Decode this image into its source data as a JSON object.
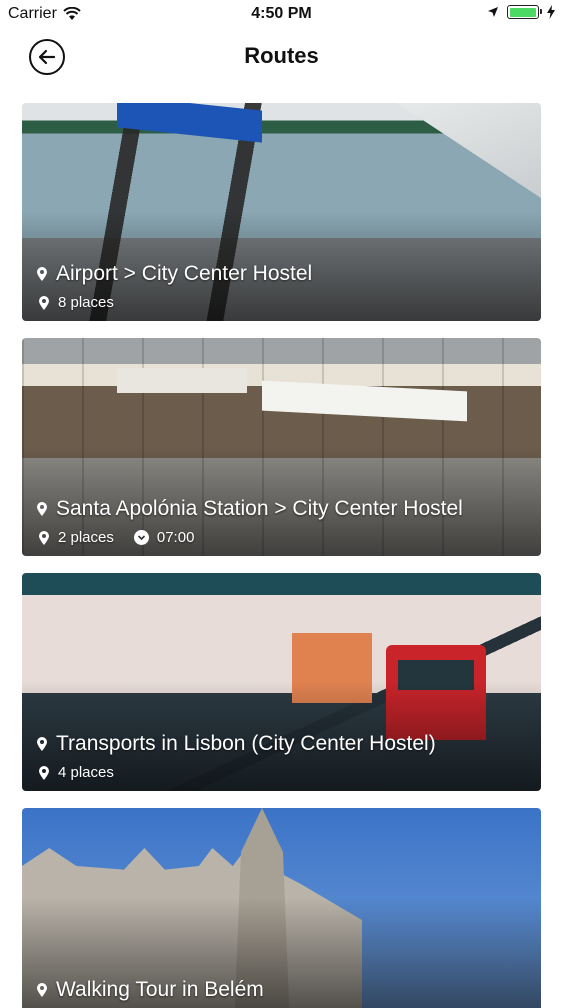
{
  "status_bar": {
    "carrier": "Carrier",
    "time": "4:50 PM",
    "icons": [
      "wifi-icon",
      "location-arrow-icon",
      "battery-icon",
      "charging-bolt-icon"
    ],
    "battery_level": 1.0
  },
  "nav": {
    "title": "Routes",
    "back_icon": "back-arrow-icon"
  },
  "routes": [
    {
      "title": "Airport > City Center Hostel",
      "places": "8 places",
      "time": ""
    },
    {
      "title": "Santa Apolónia Station > City Center Hostel",
      "places": "2 places",
      "time": "07:00"
    },
    {
      "title": "Transports in Lisbon (City Center Hostel)",
      "places": "4 places",
      "time": ""
    },
    {
      "title": "Walking Tour in Belém",
      "places": "",
      "time": ""
    }
  ],
  "colors": {
    "text": "#111111",
    "card_text": "#ffffff",
    "battery": "#4cd964"
  }
}
